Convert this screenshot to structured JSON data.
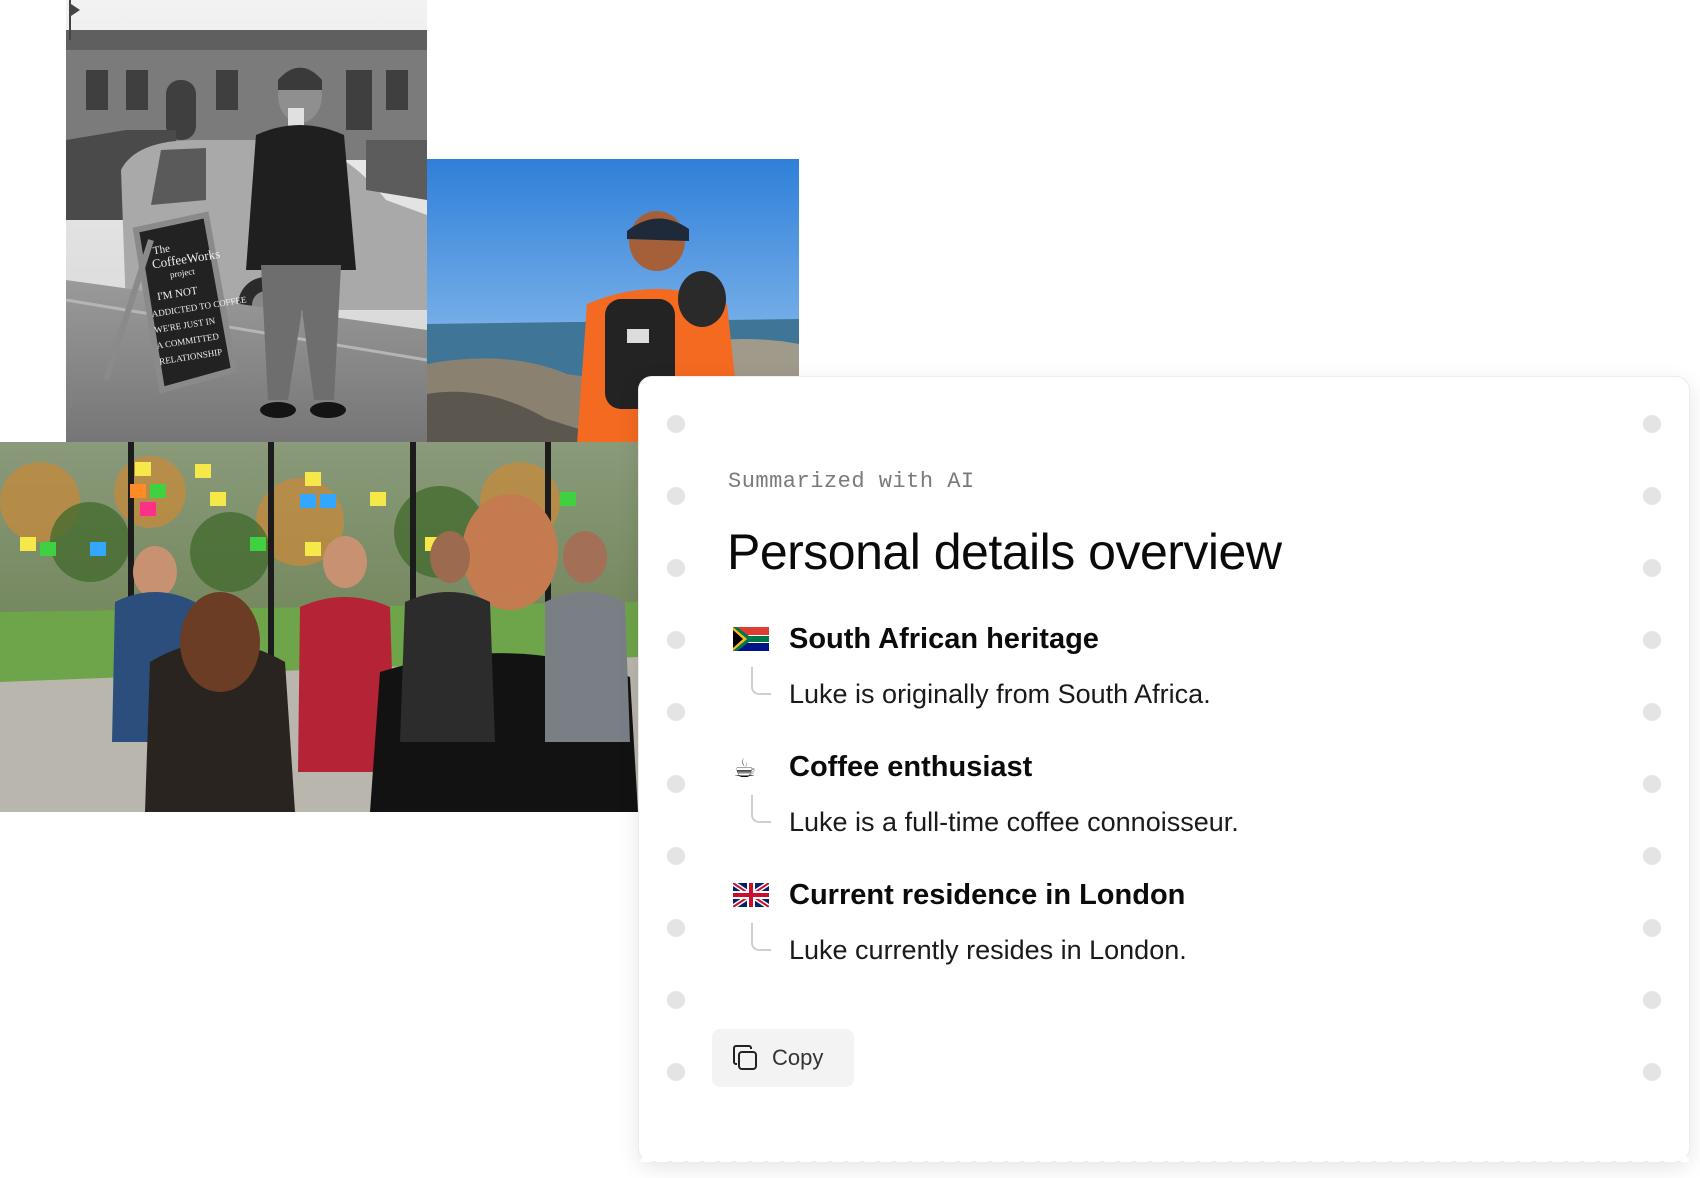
{
  "card": {
    "kicker": "Summarized with AI",
    "title": "Personal details overview",
    "items": [
      {
        "icon": "south-africa-flag-icon",
        "heading": "South African heritage",
        "body": "Luke is originally from South Africa."
      },
      {
        "icon": "coffee-icon",
        "glyph": "☕",
        "heading": "Coffee enthusiast",
        "body": "Luke is a full-time coffee connoisseur."
      },
      {
        "icon": "uk-flag-icon",
        "heading": "Current residence in London",
        "body": "Luke currently resides in London."
      }
    ],
    "copy_label": "Copy",
    "copy_icon": "copy-icon"
  },
  "photos": {
    "coffee": {
      "board_text": [
        "The",
        "CoffeeWorks",
        "project",
        "I'M NOT",
        "ADDICTED TO COFFEE",
        "WE'RE JUST IN",
        "A COMMITTED",
        "RELATIONSHIP"
      ]
    }
  },
  "colors": {
    "accent": "#f26d21",
    "card_border": "#ececec",
    "dot": "#e4e4e4",
    "copy_bg": "#f3f3f3"
  }
}
